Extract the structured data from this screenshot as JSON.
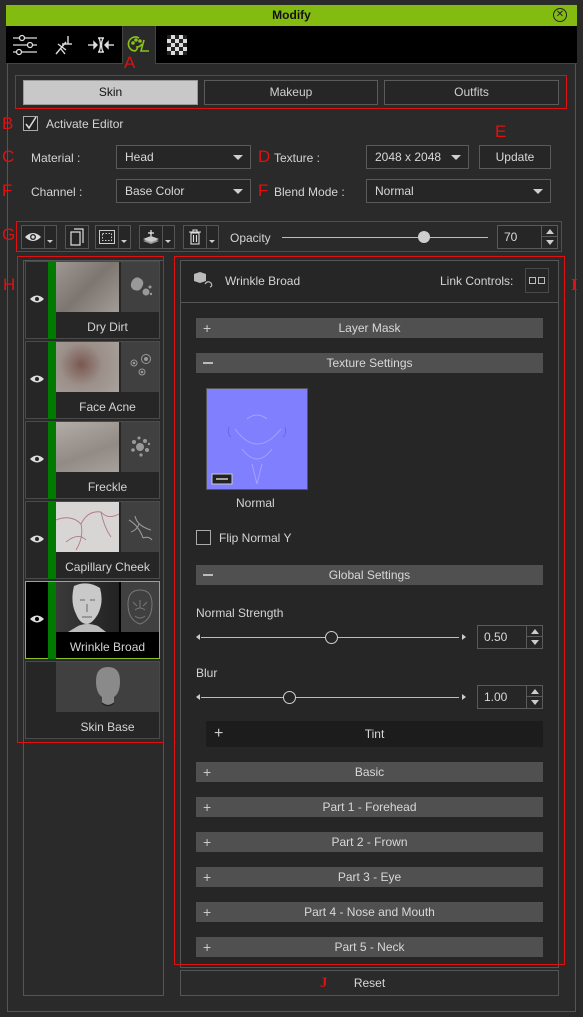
{
  "window": {
    "title": "Modify",
    "close_icon": "close-circle-icon"
  },
  "top_tabs": [
    {
      "name": "attributes",
      "icon": "sliders-icon",
      "active": false
    },
    {
      "name": "motion",
      "icon": "running-figure-icon",
      "active": false
    },
    {
      "name": "morph",
      "icon": "morph-arrows-icon",
      "active": false
    },
    {
      "name": "appearance-editor",
      "icon": "palette-icon",
      "active": true
    },
    {
      "name": "material",
      "icon": "checker-icon",
      "active": false
    }
  ],
  "annotations": {
    "A": "A",
    "B": "B",
    "C": "C",
    "D": "D",
    "E": "E",
    "F1": "F",
    "F2": "F",
    "G": "G",
    "H": "H",
    "I": "I",
    "J": "J"
  },
  "sub_tabs": [
    {
      "label": "Skin",
      "active": true
    },
    {
      "label": "Makeup",
      "active": false
    },
    {
      "label": "Outfits",
      "active": false
    }
  ],
  "activate_editor": {
    "label": "Activate Editor",
    "checked": true
  },
  "material": {
    "label": "Material :",
    "value": "Head"
  },
  "texture": {
    "label": "Texture :",
    "value": "2048 x 2048"
  },
  "update_button": "Update",
  "channel": {
    "label": "Channel :",
    "value": "Base Color"
  },
  "blend_mode": {
    "label": "Blend Mode :",
    "value": "Normal"
  },
  "toolbar": {
    "visibility_icon": "eye-icon",
    "duplicate_icon": "copy-pages-icon",
    "mask_icon": "mask-icon",
    "add_layer_icon": "add-layer-stack-icon",
    "delete_icon": "trash-icon",
    "opacity_label": "Opacity",
    "opacity_value": "70",
    "opacity_percent": 70
  },
  "layers": [
    {
      "name": "Dry Dirt",
      "visible": true,
      "enabled": true,
      "icon": "dirt-splotch-icon",
      "selected": false
    },
    {
      "name": "Face Acne",
      "visible": true,
      "enabled": true,
      "icon": "acne-circles-icon",
      "selected": false
    },
    {
      "name": "Freckle",
      "visible": true,
      "enabled": true,
      "icon": "freckle-dots-icon",
      "selected": false
    },
    {
      "name": "Capillary Cheek",
      "visible": true,
      "enabled": true,
      "icon": "capillary-lines-icon",
      "selected": false
    },
    {
      "name": "Wrinkle Broad",
      "visible": true,
      "enabled": true,
      "icon": "face-wrinkle-icon",
      "selected": true
    },
    {
      "name": "Skin Base",
      "visible": false,
      "enabled": false,
      "icon": "head-silhouette-icon",
      "selected": false
    }
  ],
  "detail": {
    "title": "Wrinkle Broad",
    "link_controls_label": "Link Controls:",
    "sections": {
      "layer_mask": "Layer Mask",
      "texture_settings": "Texture Settings",
      "global_settings": "Global Settings",
      "tint": "Tint",
      "basic": "Basic",
      "part1": "Part 1 - Forehead",
      "part2": "Part 2 - Frown",
      "part3": "Part 3 - Eye",
      "part4": "Part 4 - Nose and Mouth",
      "part5": "Part 5 - Neck"
    },
    "normal_map_label": "Normal",
    "flip_normal": {
      "label": "Flip Normal Y",
      "checked": false
    },
    "normal_strength": {
      "label": "Normal Strength",
      "value": "0.50",
      "slider_fraction": 0.5
    },
    "blur": {
      "label": "Blur",
      "value": "1.00",
      "slider_fraction": 0.34
    }
  },
  "reset_button": "Reset",
  "colors": {
    "accent_green": "#84bb10",
    "layer_bar_green": "#007a00",
    "annotation_red": "#e01010"
  }
}
